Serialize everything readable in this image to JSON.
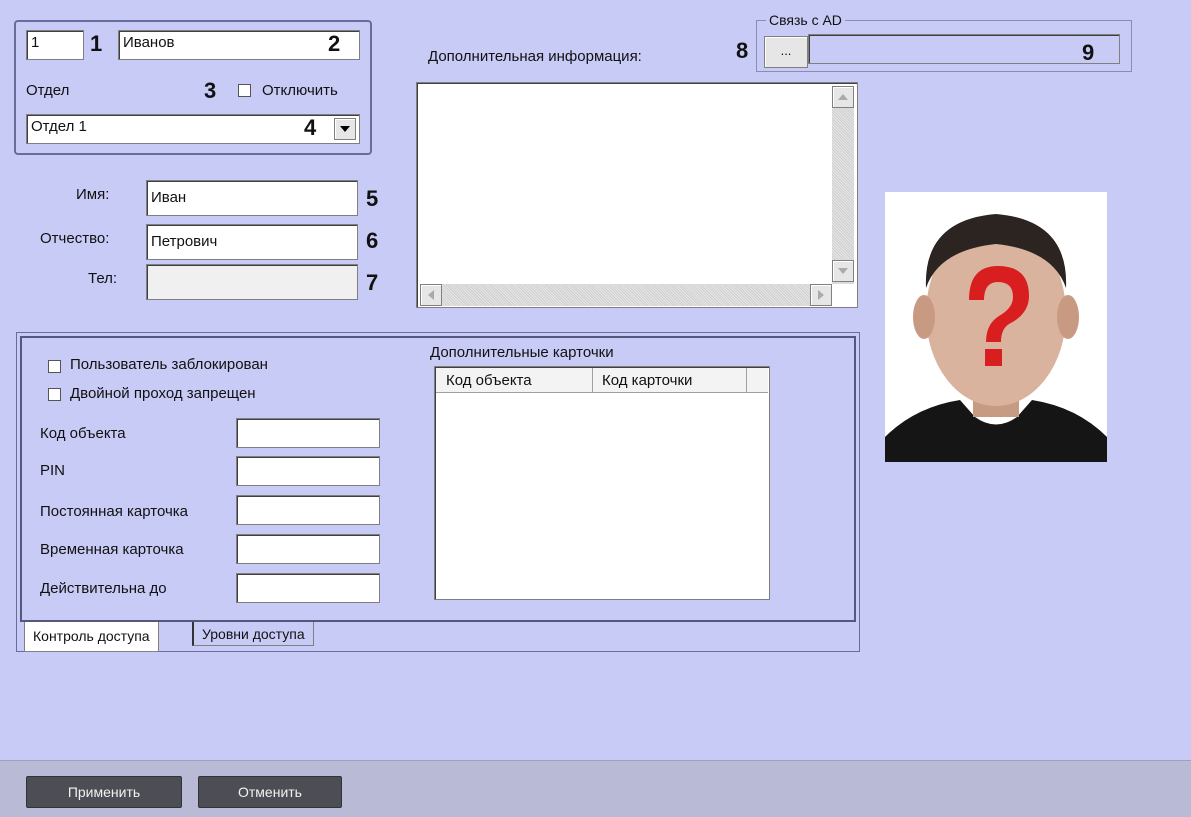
{
  "header": {
    "id_value": "1",
    "surname_value": "Иванов",
    "department_label": "Отдел",
    "disable_label": "Отключить",
    "department_value": "Отдел 1"
  },
  "person": {
    "first_name_label": "Имя:",
    "first_name_value": "Иван",
    "patronymic_label": "Отчество:",
    "patronymic_value": "Петрович",
    "phone_label": "Тел:",
    "phone_value": ""
  },
  "extra_info": {
    "label": "Дополнительная информация:",
    "value": ""
  },
  "ad": {
    "group_label": "Связь с AD",
    "browse_button": "...",
    "value": ""
  },
  "numbers": [
    "1",
    "2",
    "3",
    "4",
    "5",
    "6",
    "7",
    "8",
    "9"
  ],
  "access": {
    "blocked_label": "Пользователь заблокирован",
    "double_pass_label": "Двойной проход запрещен",
    "object_code_label": "Код объекта",
    "pin_label": "PIN",
    "permanent_card_label": "Постоянная карточка",
    "temp_card_label": "Временная карточка",
    "valid_until_label": "Действительна до",
    "extra_cards_label": "Дополнительные карточки",
    "extra_cards_columns": [
      "Код объекта",
      "Код карточки"
    ]
  },
  "tabs": [
    "Контроль доступа",
    "Уровни доступа"
  ],
  "footer": {
    "apply_label": "Применить",
    "cancel_label": "Отменить"
  }
}
